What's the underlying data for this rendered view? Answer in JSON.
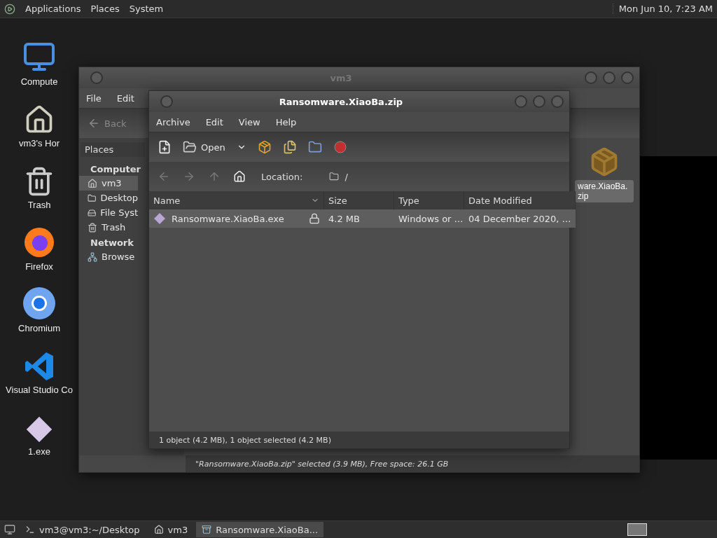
{
  "top_panel": {
    "menus": [
      "Applications",
      "Places",
      "System"
    ],
    "clock": "Mon Jun 10,  7:23 AM"
  },
  "desktop_icons": [
    {
      "label": "Compute",
      "kind": "computer"
    },
    {
      "label": "vm3's Hor",
      "kind": "home"
    },
    {
      "label": "Trash",
      "kind": "trash"
    },
    {
      "label": "Firefox",
      "kind": "firefox"
    },
    {
      "label": "Chromium",
      "kind": "chromium"
    },
    {
      "label": "Visual Studio Co",
      "kind": "vscode"
    },
    {
      "label": "1.exe",
      "kind": "exe"
    }
  ],
  "file_manager": {
    "title": "vm3",
    "menus": [
      "File",
      "Edit"
    ],
    "back_button": "Back",
    "sidebar": {
      "title": "Places",
      "sections": [
        {
          "heading": "Computer",
          "items": [
            {
              "label": "vm3",
              "kind": "home",
              "selected": true
            },
            {
              "label": "Desktop",
              "kind": "desktop",
              "selected": false
            },
            {
              "label": "File Syst",
              "kind": "drive",
              "selected": false
            },
            {
              "label": "Trash",
              "kind": "trash",
              "selected": false
            }
          ]
        },
        {
          "heading": "Network",
          "items": [
            {
              "label": "Browse",
              "kind": "network",
              "selected": false
            }
          ]
        }
      ]
    },
    "files": [
      {
        "name": "ware.XiaoBa.zip",
        "selected": true
      }
    ],
    "status": "\"Ransomware.XiaoBa.zip\" selected (3.9 MB), Free space: 26.1 GB"
  },
  "archive_manager": {
    "title": "Ransomware.XiaoBa.zip",
    "menus": [
      "Archive",
      "Edit",
      "View",
      "Help"
    ],
    "toolbar": {
      "open_button": "Open"
    },
    "location": {
      "label": "Location:",
      "path": "/"
    },
    "columns": [
      "Name",
      "Size",
      "Type",
      "Date Modified"
    ],
    "rows": [
      {
        "name": "Ransomware.XiaoBa.exe",
        "locked": true,
        "size": "4.2 MB",
        "type": "Windows or …",
        "date": "04 December 2020, …",
        "selected": true
      }
    ],
    "status": "1 object (4.2 MB), 1 object selected (4.2 MB)"
  },
  "taskbar": {
    "tasks": [
      {
        "label": "vm3@vm3:~/Desktop",
        "kind": "terminal",
        "selected": false
      },
      {
        "label": "vm3",
        "kind": "folder",
        "selected": false
      },
      {
        "label": "Ransomware.XiaoBa...",
        "kind": "archive",
        "selected": true
      }
    ]
  }
}
